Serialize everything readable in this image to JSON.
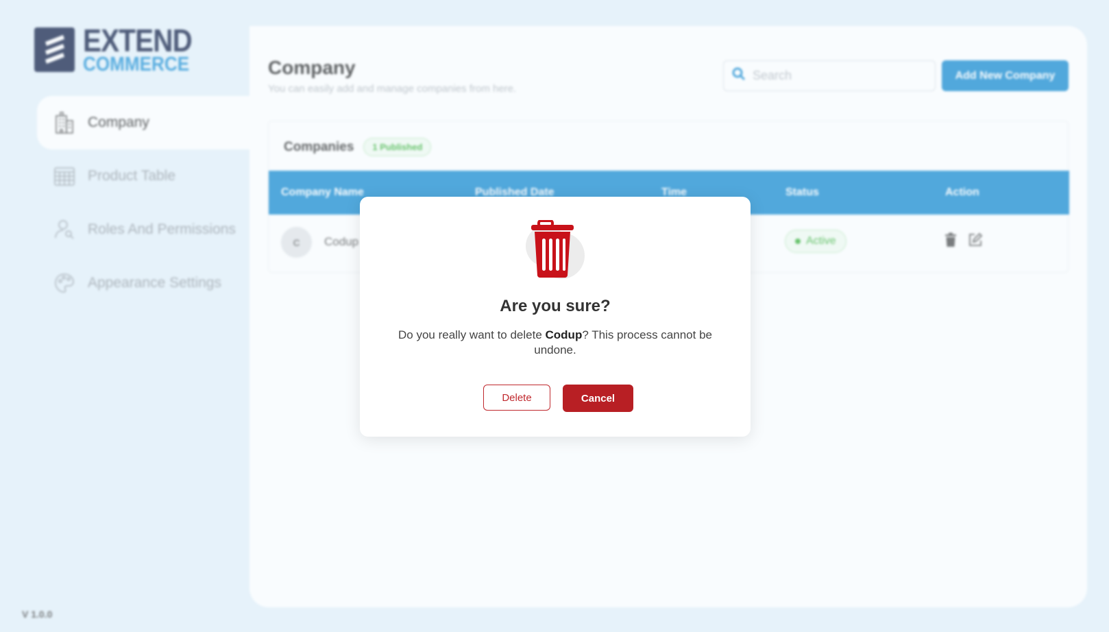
{
  "brand": {
    "line1": "EXTEND",
    "line2": "COMMERCE"
  },
  "sidebar": {
    "items": [
      {
        "label": "Company",
        "icon": "building-icon",
        "active": true
      },
      {
        "label": "Product Table",
        "icon": "table-icon",
        "active": false
      },
      {
        "label": "Roles And Permissions",
        "icon": "user-key-icon",
        "active": false
      },
      {
        "label": "Appearance Settings",
        "icon": "palette-icon",
        "active": false
      }
    ],
    "version": "V 1.0.0"
  },
  "header": {
    "title": "Company",
    "subtitle": "You can easily add and manage companies from here.",
    "search_placeholder": "Search",
    "add_button": "Add New Company"
  },
  "table": {
    "title": "Companies",
    "badge": "1 Published",
    "columns": [
      "Company Name",
      "Published Date",
      "Time",
      "Status",
      "Action"
    ],
    "rows": [
      {
        "avatar": "C",
        "name": "Codup",
        "status": "Active"
      }
    ]
  },
  "modal": {
    "title": "Are you sure?",
    "text_before": "Do you really want to delete ",
    "text_bold": "Codup",
    "text_after": "? This process cannot be undone.",
    "delete_label": "Delete",
    "cancel_label": "Cancel"
  },
  "colors": {
    "primary": "#1f8fd2",
    "danger": "#b81f24",
    "success": "#3fb43f",
    "background": "#e6f2fa",
    "brand_dark": "#1c2a4f"
  }
}
